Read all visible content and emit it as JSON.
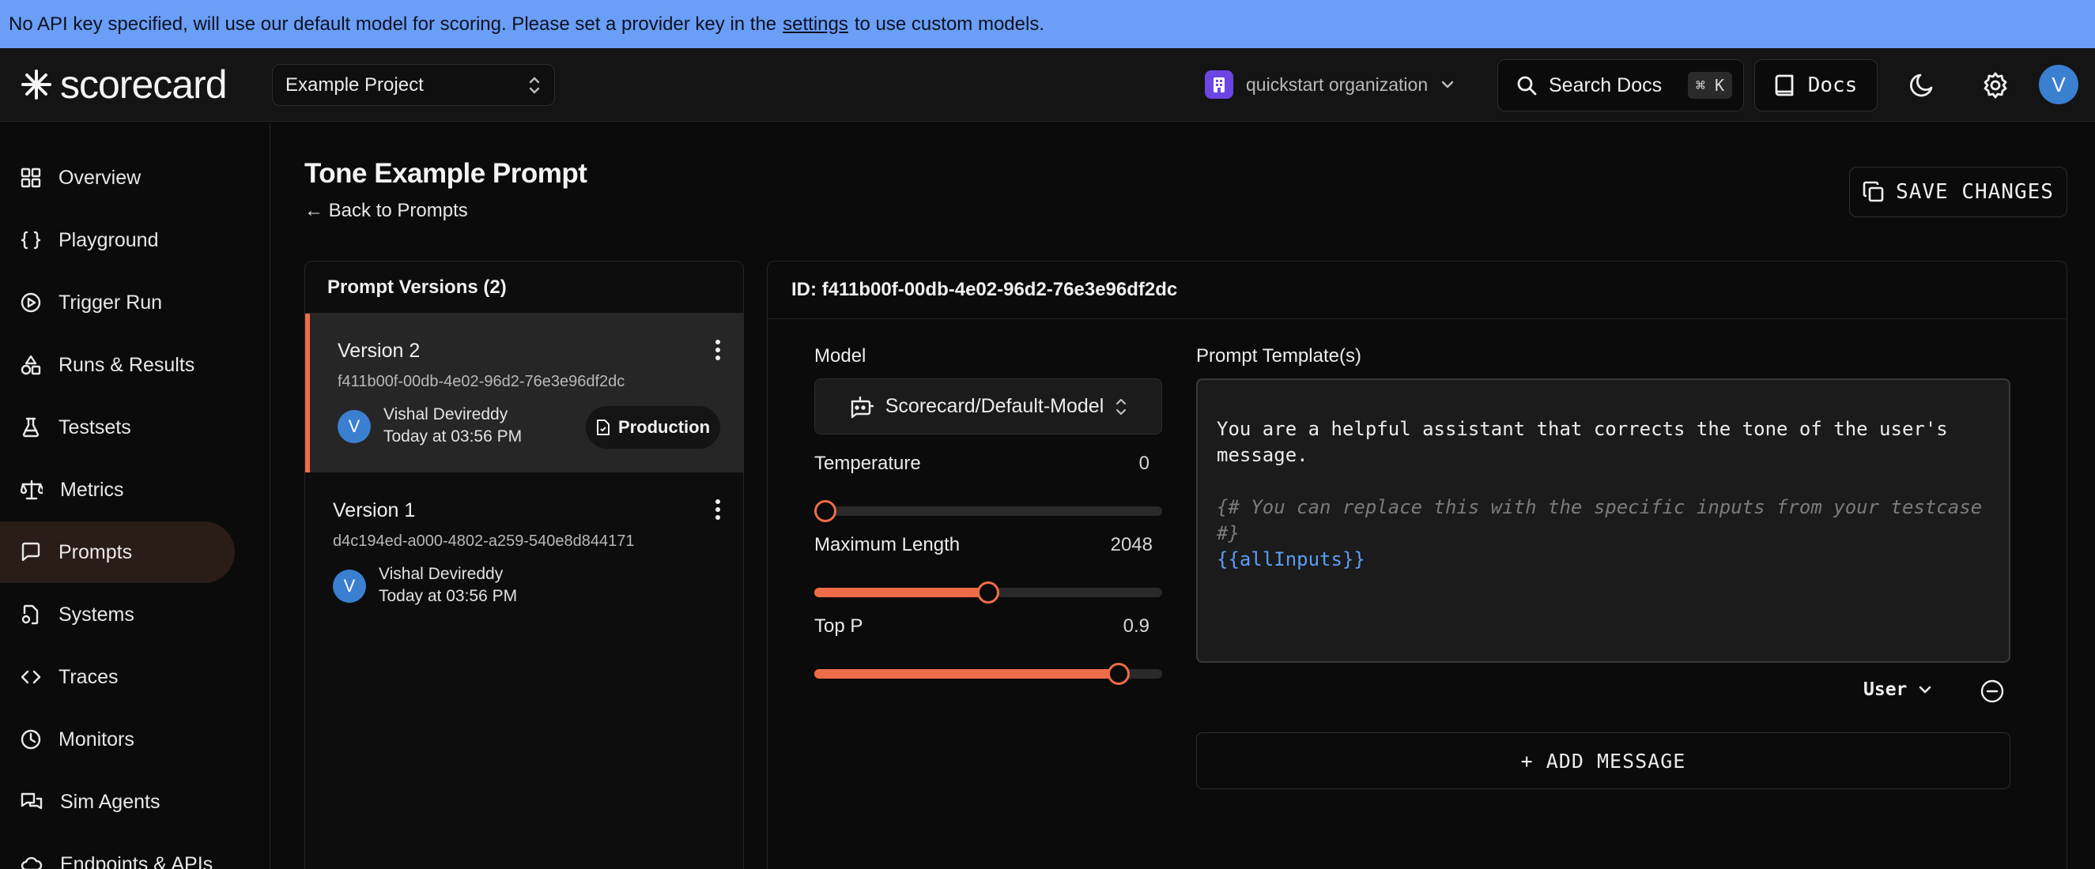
{
  "banner": {
    "text_before": "No API key specified, will use our default model for scoring. Please set a provider key in the",
    "link": "settings",
    "text_after": "to use custom models."
  },
  "header": {
    "logo": "scorecard",
    "project": "Example Project",
    "organization": "quickstart organization",
    "search_label": "Search Docs",
    "search_shortcut": "⌘ K",
    "docs_label": "Docs",
    "avatar_initial": "V"
  },
  "sidebar": {
    "items": [
      {
        "label": "Overview",
        "icon": "grid-icon"
      },
      {
        "label": "Playground",
        "icon": "braces-icon"
      },
      {
        "label": "Trigger Run",
        "icon": "play-circle-icon"
      },
      {
        "label": "Runs & Results",
        "icon": "shapes-icon"
      },
      {
        "label": "Testsets",
        "icon": "flask-icon"
      },
      {
        "label": "Metrics",
        "icon": "scale-icon"
      },
      {
        "label": "Prompts",
        "icon": "message-square-icon"
      },
      {
        "label": "Systems",
        "icon": "file-cog-icon"
      },
      {
        "label": "Traces",
        "icon": "code-icon"
      },
      {
        "label": "Monitors",
        "icon": "clock-icon"
      },
      {
        "label": "Sim Agents",
        "icon": "messages-icon"
      },
      {
        "label": "Endpoints & APIs",
        "icon": "cloud-icon"
      }
    ],
    "active": "Prompts"
  },
  "page": {
    "title": "Tone Example Prompt",
    "back_link": "← Back to Prompts",
    "save_button": "SAVE CHANGES"
  },
  "versions": {
    "header": "Prompt Versions (2)",
    "items": [
      {
        "name": "Version 2",
        "id": "f411b00f-00db-4e02-96d2-76e3e96df2dc",
        "author": "Vishal Devireddy",
        "time": "Today at 03:56 PM",
        "avatar_initial": "V",
        "badge": "Production"
      },
      {
        "name": "Version 1",
        "id": "d4c194ed-a000-4802-a259-540e8d844171",
        "author": "Vishal Devireddy",
        "time": "Today at 03:56 PM",
        "avatar_initial": "V"
      }
    ]
  },
  "editor": {
    "id_label": "ID: f411b00f-00db-4e02-96d2-76e3e96df2dc",
    "model_label": "Model",
    "model_value": "Scorecard/Default-Model",
    "temperature": {
      "label": "Temperature",
      "value": "0",
      "fraction": 0.0
    },
    "max_length": {
      "label": "Maximum Length",
      "value": "2048",
      "fraction": 0.5
    },
    "top_p": {
      "label": "Top P",
      "value": "0.9",
      "fraction": 0.9
    },
    "template_label": "Prompt Template(s)",
    "template_text": "You are a helpful assistant that corrects the tone of the user's message.",
    "template_comment": "{# You can replace this with the specific inputs from your testcase #}",
    "template_var": "{{allInputs}}",
    "role": "User",
    "add_message": "+ ADD MESSAGE"
  },
  "colors": {
    "accent": "#ef6c48",
    "banner": "#6a9ef7",
    "avatar": "#3a7fd0",
    "org_badge": "#6b46e4"
  }
}
